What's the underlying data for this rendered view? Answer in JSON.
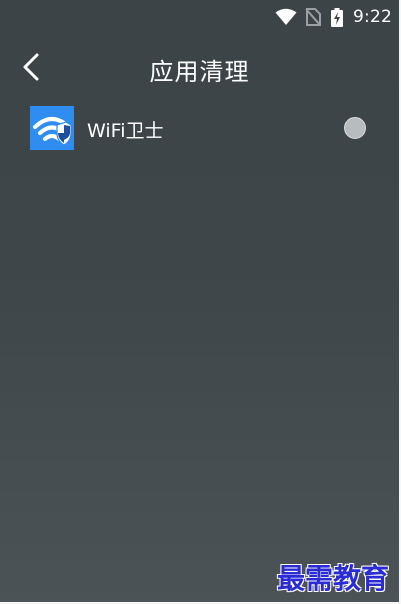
{
  "status_bar": {
    "time": "9:22",
    "icons": [
      "wifi-icon",
      "no-sim-icon",
      "battery-charging-icon"
    ]
  },
  "toolbar": {
    "back_icon": "chevron-left-icon",
    "title": "应用清理"
  },
  "app_list": [
    {
      "name": "WiFi卫士",
      "icon": "wifi-shield-app-icon",
      "selected": false
    }
  ],
  "watermark": "最需教育",
  "colors": {
    "background_top": "#3d4448",
    "background_bottom": "#4b5357",
    "app_icon_blue": "#2f8cf1",
    "radio_unselected": "#b9bcbe",
    "watermark": "#2a2bd2"
  }
}
